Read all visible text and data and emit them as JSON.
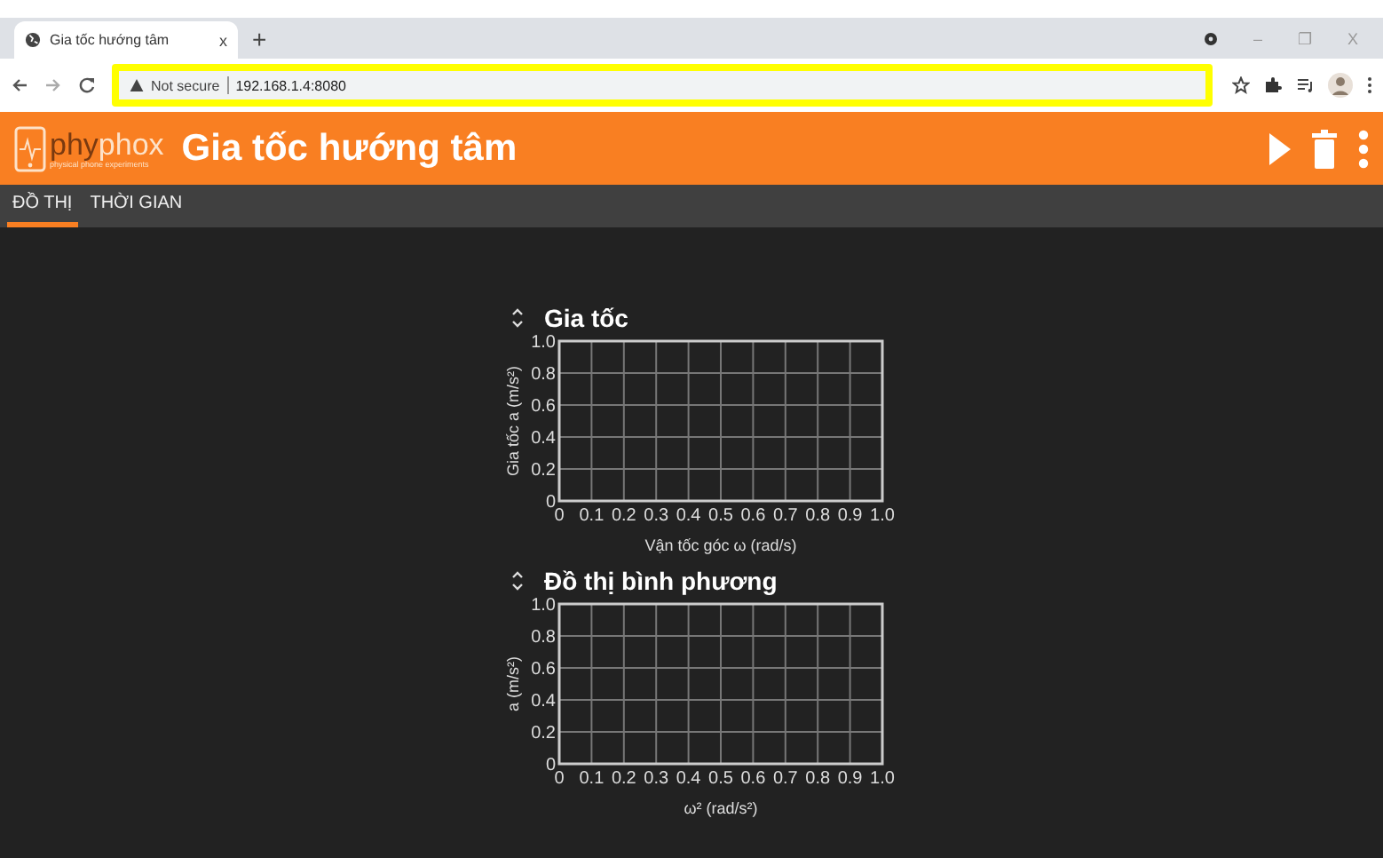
{
  "browser": {
    "tab": {
      "title": "Gia tốc hướng tâm",
      "close": "x"
    },
    "new_tab": "+",
    "window_controls": [
      "–",
      "❐",
      "X"
    ],
    "address": {
      "security": "Not secure",
      "url": "192.168.1.4:8080",
      "highlighted": true
    }
  },
  "app": {
    "logo": {
      "wordmark_dark": "phy",
      "wordmark_light": "phox",
      "tagline": "physical phone experiments"
    },
    "title": "Gia tốc hướng tâm"
  },
  "tabs": [
    {
      "label": "ĐỒ THỊ",
      "selected": true
    },
    {
      "label": "THỜI GIAN",
      "selected": false
    }
  ],
  "graphs": [
    {
      "title": "Gia tốc",
      "chart_data": {
        "type": "line",
        "grid": true,
        "xlabel": "Vận tốc góc ω (rad/s)",
        "ylabel": "Gia tốc a (m/s²)",
        "xlim": [
          0,
          1
        ],
        "ylim": [
          0,
          1
        ],
        "xticks": [
          0,
          0.1,
          0.2,
          0.3,
          0.4,
          0.5,
          0.6,
          0.7,
          0.8,
          0.9,
          {
            "value": 1,
            "label": "1.0"
          }
        ],
        "yticks": [
          0,
          0.2,
          0.4,
          0.6,
          0.8,
          {
            "value": 1,
            "label": "1.0"
          }
        ]
      }
    },
    {
      "title": "Đồ thị bình phương",
      "chart_data": {
        "type": "line",
        "grid": true,
        "xlabel": "ω² (rad/s²)",
        "ylabel": "a (m/s²)",
        "xlim": [
          0,
          1
        ],
        "ylim": [
          0,
          1
        ],
        "xticks": [
          0,
          0.1,
          0.2,
          0.3,
          0.4,
          0.5,
          0.6,
          0.7,
          0.8,
          0.9,
          {
            "value": 1,
            "label": "1.0"
          }
        ],
        "yticks": [
          0,
          0.2,
          0.4,
          0.6,
          0.8,
          {
            "value": 1,
            "label": "1.0"
          }
        ]
      }
    }
  ]
}
